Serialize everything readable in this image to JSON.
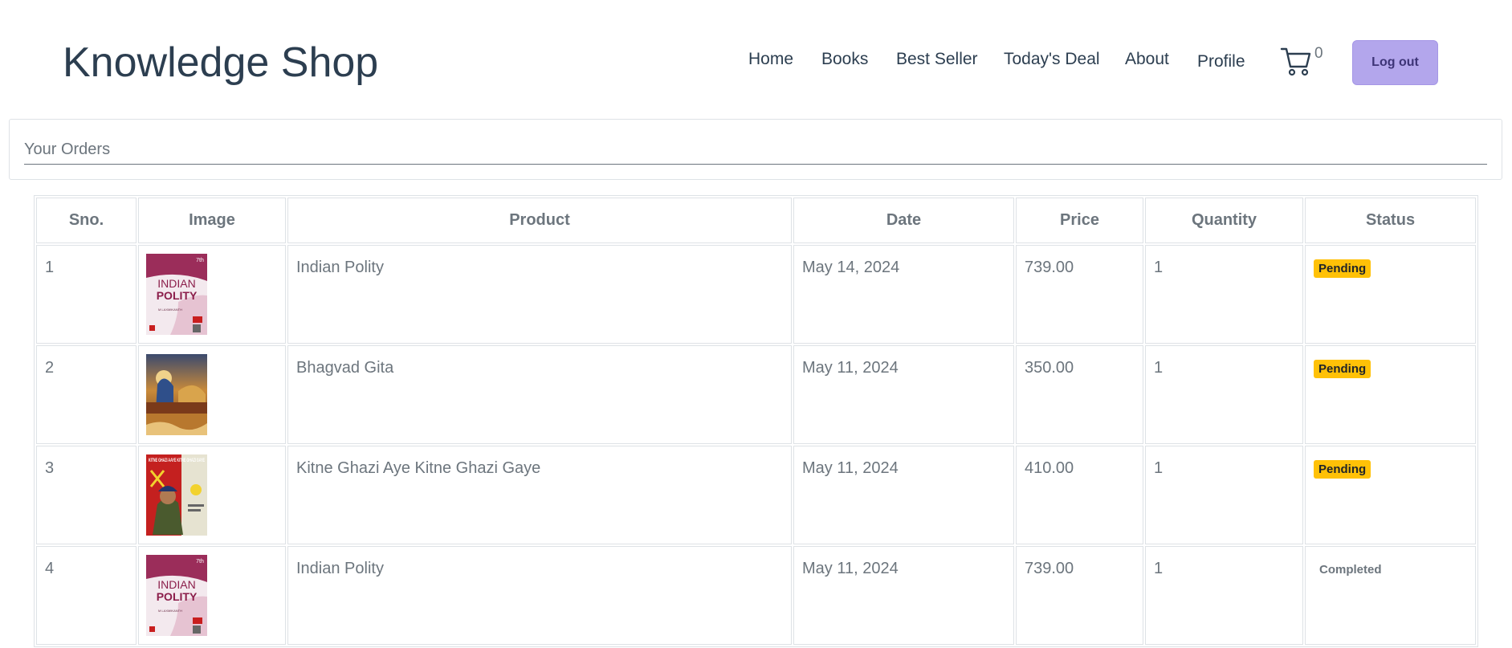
{
  "brand": "Knowledge Shop",
  "nav": {
    "home": "Home",
    "books": "Books",
    "best_seller": "Best Seller",
    "todays_deal": "Today's Deal",
    "about": "About",
    "profile": "Profile"
  },
  "cart": {
    "icon": "cart-icon",
    "count": "0"
  },
  "logout_label": "Log out",
  "orders_heading": "Your Orders",
  "table": {
    "headers": [
      "Sno.",
      "Image",
      "Product",
      "Date",
      "Price",
      "Quantity",
      "Status"
    ],
    "rows": [
      {
        "sno": "1",
        "cover": "indian-polity-cover",
        "product": "Indian Polity",
        "date": "May 14, 2024",
        "price": "739.00",
        "quantity": "1",
        "status": "Pending"
      },
      {
        "sno": "2",
        "cover": "bhagvad-gita-cover",
        "product": "Bhagvad Gita",
        "date": "May 11, 2024",
        "price": "350.00",
        "quantity": "1",
        "status": "Pending"
      },
      {
        "sno": "3",
        "cover": "kitne-ghazi-cover",
        "product": "Kitne Ghazi Aye Kitne Ghazi Gaye",
        "date": "May 11, 2024",
        "price": "410.00",
        "quantity": "1",
        "status": "Pending"
      },
      {
        "sno": "4",
        "cover": "indian-polity-cover",
        "product": "Indian Polity",
        "date": "May 11, 2024",
        "price": "739.00",
        "quantity": "1",
        "status": "Completed"
      }
    ]
  },
  "covers": {
    "indian_polity": {
      "title_line1": "INDIAN",
      "title_line2": "POLITY",
      "edition": "7th",
      "author": "M LAXMIKANTH"
    },
    "kitne_ghazi": {
      "title": "KITNE GHAZI AAYE KITNE GHAZI GAYE"
    }
  },
  "colors": {
    "accent_button": "#b3a6ec",
    "pending_badge": "#ffc107",
    "text_primary": "#2c3e50",
    "text_muted": "#6c757d"
  }
}
